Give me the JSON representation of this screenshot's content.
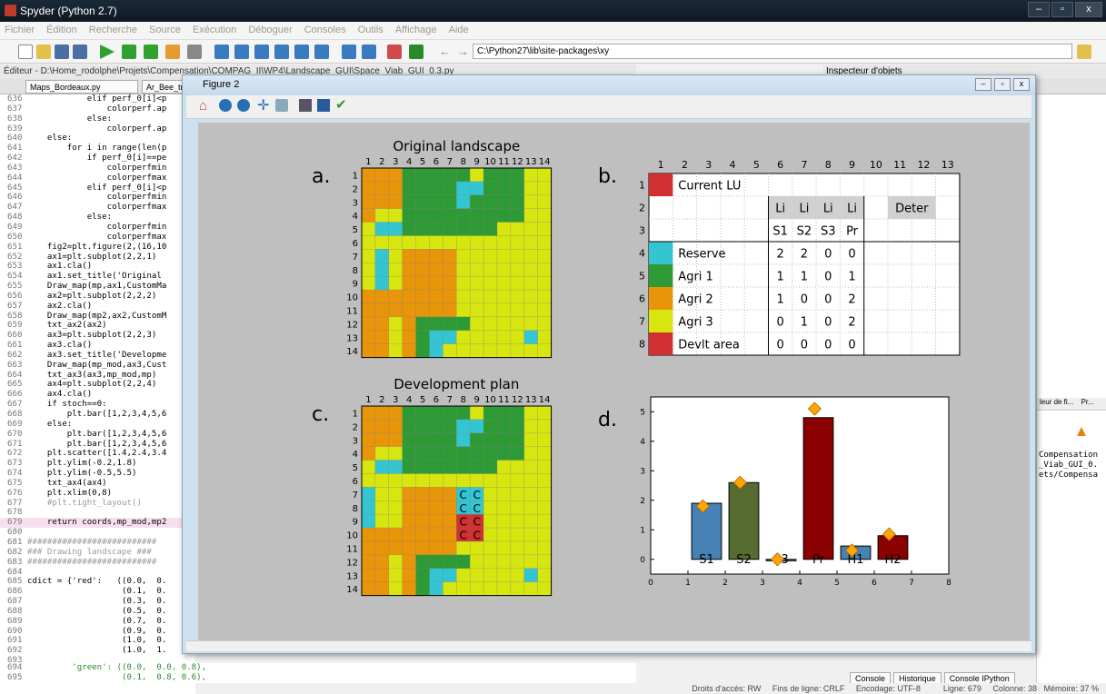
{
  "window": {
    "title": "Spyder (Python 2.7)",
    "controls": [
      "–",
      "▫",
      "x"
    ]
  },
  "menu": [
    "Fichier",
    "Édition",
    "Recherche",
    "Source",
    "Exécution",
    "Déboguer",
    "Consoles",
    "Outils",
    "Affichage",
    "Aide"
  ],
  "toolbar": {
    "path": "C:\\Python27\\lib\\site-packages\\xy"
  },
  "editor_header": "Éditeur - D:\\Home_rodolphe\\Projets\\Compensation\\COMPAG_II\\WP4\\Landscape_GUI\\Space_Viab_GUI_0.3.py",
  "inspector_header": "Inspecteur d'objets",
  "tabs": [
    "Maps_Bordeaux.py",
    "Ar_Bee_tra"
  ],
  "code_lines": [
    [
      "636",
      "            elif perf_0[i]<p"
    ],
    [
      "637",
      "                colorperf.ap"
    ],
    [
      "638",
      "            else:"
    ],
    [
      "639",
      "                colorperf.ap"
    ],
    [
      "640",
      "    else:"
    ],
    [
      "641",
      "        for i in range(len(p"
    ],
    [
      "642",
      "            if perf_0[i]==pe"
    ],
    [
      "643",
      "                colorperfmin"
    ],
    [
      "644",
      "                colorperfmax"
    ],
    [
      "645",
      "            elif perf_0[i]<p"
    ],
    [
      "646",
      "                colorperfmin"
    ],
    [
      "647",
      "                colorperfmax"
    ],
    [
      "648",
      "            else:"
    ],
    [
      "649",
      "                colorperfmin"
    ],
    [
      "650",
      "                colorperfmax"
    ],
    [
      "651",
      "    fig2=plt.figure(2,(16,10"
    ],
    [
      "652",
      "    ax1=plt.subplot(2,2,1)"
    ],
    [
      "653",
      "    ax1.cla()"
    ],
    [
      "654",
      "    ax1.set_title('Original "
    ],
    [
      "655",
      "    Draw_map(mp,ax1,CustomMa"
    ],
    [
      "656",
      "    ax2=plt.subplot(2,2,2)"
    ],
    [
      "657",
      "    ax2.cla()"
    ],
    [
      "658",
      "    Draw_map(mp2,ax2,CustomM"
    ],
    [
      "659",
      "    txt_ax2(ax2)"
    ],
    [
      "660",
      "    ax3=plt.subplot(2,2,3)"
    ],
    [
      "661",
      "    ax3.cla()"
    ],
    [
      "662",
      "    ax3.set_title('Developme"
    ],
    [
      "663",
      "    Draw_map(mp_mod,ax3,Cust"
    ],
    [
      "664",
      "    txt_ax3(ax3,mp_mod,mp)"
    ],
    [
      "665",
      "    ax4=plt.subplot(2,2,4)"
    ],
    [
      "666",
      "    ax4.cla()"
    ],
    [
      "667",
      "    if stoch==0:"
    ],
    [
      "668",
      "        plt.bar([1,2,3,4,5,6"
    ],
    [
      "669",
      "    else:"
    ],
    [
      "670",
      "        plt.bar([1,2,3,4,5,6"
    ],
    [
      "671",
      "        plt.bar([1,2,3,4,5,6"
    ],
    [
      "672",
      "    plt.scatter([1.4,2.4,3.4"
    ],
    [
      "673",
      "    plt.ylim(-0.2,1.8)"
    ],
    [
      "674",
      "    plt.ylim(-0.5,5.5)"
    ],
    [
      "675",
      "    txt_ax4(ax4)"
    ],
    [
      "676",
      "    plt.xlim(0,8)"
    ],
    [
      "677",
      "    #plt.tight_layout()"
    ],
    [
      "678",
      ""
    ],
    [
      "679",
      "    return coords,mp_mod,mp2"
    ],
    [
      "680",
      ""
    ],
    [
      "681",
      "##########################"
    ],
    [
      "682",
      "### Drawing landscape ###"
    ],
    [
      "683",
      "##########################"
    ],
    [
      "684",
      ""
    ],
    [
      "685",
      "cdict = {'red':   ((0.0,  0."
    ],
    [
      "686",
      "                   (0.1,  0."
    ],
    [
      "687",
      "                   (0.3,  0."
    ],
    [
      "688",
      "                   (0.5,  0."
    ],
    [
      "689",
      "                   (0.7,  0."
    ],
    [
      "690",
      "                   (0.9,  0."
    ],
    [
      "691",
      "                   (1.0,  0."
    ],
    [
      "692",
      "                   (1.0,  1."
    ],
    [
      "693",
      ""
    ]
  ],
  "code_bottom": [
    [
      "694",
      "         'green': ((0.0,  0.0, 0.8),"
    ],
    [
      "695",
      "                   (0.1,  0.8, 0.6),"
    ]
  ],
  "console_lines": [
    "Compensation",
    "_Viab_GUI_0.",
    "ets/Compensa"
  ],
  "console_tabs": [
    "Console",
    "Historique",
    "Console IPython"
  ],
  "right_tabs": [
    "leur de fi...",
    "Pr..."
  ],
  "status": "Droits d'accès: RW     Fins de ligne: CRLF     Encodage: UTF-8          Ligne: 679     Colonne: 38   Mémoire: 37 %",
  "figure": {
    "title": "Figure 2"
  },
  "panels": {
    "a": "a.",
    "b": "b.",
    "c": "c.",
    "d": "d."
  },
  "map_titles": {
    "original": "Original landscape",
    "development": "Development plan"
  },
  "map_ticks": [
    "1",
    "2",
    "3",
    "4",
    "5",
    "6",
    "7",
    "8",
    "9",
    "10",
    "11",
    "12",
    "13",
    "14"
  ],
  "colors": {
    "orange": "#e8950a",
    "green": "#2e9a35",
    "yellow": "#d7e60f",
    "cyan": "#33c6d2",
    "red": "#d03030",
    "bg": "#bfbfbf"
  },
  "landscape_original": [
    "OOOGGGGGYGGGYY",
    "OOOGGGGCCGGGYY",
    "OOOGGGGCGGGGYY",
    "OYYGGGGGGGGGYY",
    "YCCGGGGGGGYYYY",
    "YYYYYYYYYYYYYY",
    "YCYOOOOYYYYYYY",
    "YCYOOOOYYYYYYY",
    "YCYOOOOYYYYYYY",
    "OOOOOOOYYYYYYY",
    "OOOOOOOYYYYYYY",
    "OOYOGGGGYYYYYY",
    "OOYOGCCYYYYYCY",
    "OOYOGCYYYYYYYY"
  ],
  "landscape_development": [
    "OOOGGGGGYGGGYY",
    "OOOGGGGCCGGGYY",
    "OOOGGGGCGGGGYY",
    "OYYGGGGGGGGGYY",
    "YCCGGGGGGGYYYY",
    "YYYYYYYYYYYYYY",
    "CYYOOOOCCYYYYY",
    "CYYOOOOCCYYYYY",
    "CYYOOOORRYYYYY",
    "OOOOOOORRYYYYY",
    "OOOOOOOYYYYYYY",
    "OOYOGGGGYYYYYY",
    "OOYOGCCYYYYYCY",
    "OOYOGCYYYYYYYY"
  ],
  "dev_labels": [
    [
      "7",
      "8",
      "C"
    ],
    [
      "7",
      "9",
      "C"
    ],
    [
      "8",
      "8",
      "C"
    ],
    [
      "8",
      "9",
      "C"
    ],
    [
      "9",
      "8",
      "C"
    ],
    [
      "9",
      "9",
      "C"
    ],
    [
      "10",
      "8",
      "C"
    ],
    [
      "10",
      "9",
      "C"
    ]
  ],
  "table": {
    "col_ticks": [
      "1",
      "2",
      "3",
      "4",
      "5",
      "6",
      "7",
      "8",
      "9",
      "10",
      "11",
      "12",
      "13"
    ],
    "row_ticks": [
      "1",
      "2",
      "3",
      "4",
      "5",
      "6",
      "7",
      "8"
    ],
    "current_lu": "Current LU",
    "li": [
      "Li",
      "Li",
      "Li",
      "Li"
    ],
    "deter": "Deter",
    "subheads": [
      "S1",
      "S2",
      "S3",
      "Pr"
    ],
    "rows": [
      {
        "label": "Reserve",
        "color": "#33c6d2",
        "vals": [
          "2",
          "2",
          "0",
          "0"
        ]
      },
      {
        "label": "Agri 1",
        "color": "#2e9a35",
        "vals": [
          "1",
          "1",
          "0",
          "1"
        ]
      },
      {
        "label": "Agri 2",
        "color": "#e8950a",
        "vals": [
          "1",
          "0",
          "0",
          "2"
        ]
      },
      {
        "label": "Agri 3",
        "color": "#d7e60f",
        "vals": [
          "0",
          "1",
          "0",
          "2"
        ]
      },
      {
        "label": "Devlt area",
        "color": "#d03030",
        "vals": [
          "0",
          "0",
          "0",
          "0"
        ]
      }
    ]
  },
  "chart_data": {
    "type": "bar",
    "categories": [
      "S1",
      "S2",
      "S3",
      "Pr",
      "H1",
      "H2"
    ],
    "x": [
      1.5,
      2.5,
      3.5,
      4.5,
      5.5,
      6.5
    ],
    "values": [
      1.9,
      2.6,
      -0.05,
      4.8,
      0.45,
      0.8
    ],
    "bar_colors": [
      "#4682b4",
      "#556b2f",
      "#4682b4",
      "#8b0000",
      "#4682b4",
      "#8b0000"
    ],
    "markers": {
      "x": [
        1.4,
        2.4,
        3.4,
        4.4,
        5.4,
        6.4
      ],
      "y": [
        1.8,
        2.6,
        0.0,
        5.1,
        0.3,
        0.85
      ],
      "color": "#ffa500"
    },
    "xlim": [
      0,
      8
    ],
    "ylim": [
      -0.5,
      5.5
    ],
    "xticks": [
      "0",
      "1",
      "2",
      "3",
      "4",
      "5",
      "6",
      "7",
      "8"
    ],
    "yticks": [
      "0",
      "1",
      "2",
      "3",
      "4",
      "5"
    ],
    "title": "",
    "xlabel": "",
    "ylabel": ""
  }
}
